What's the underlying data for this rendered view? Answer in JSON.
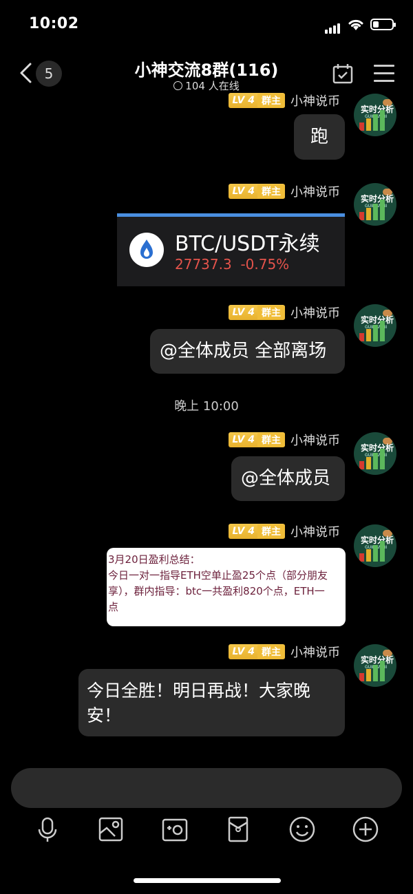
{
  "status_bar": {
    "time": "10:02"
  },
  "header": {
    "back_count": "5",
    "title": "小神交流8群(116)",
    "online": "104 人在线"
  },
  "messages": [
    {
      "sender": "小神说币",
      "level": "LV 4",
      "role": "群主",
      "text": "跑"
    },
    {
      "sender": "小神说币",
      "level": "LV 4",
      "role": "群主",
      "card": {
        "title": "BTC/USDT永续",
        "price": "27737.3",
        "change": "-0.75%"
      }
    },
    {
      "sender": "小神说币",
      "level": "LV 4",
      "role": "群主",
      "text": "@全体成员 全部离场"
    },
    {
      "timestamp": "晚上 10:00"
    },
    {
      "sender": "小神说币",
      "level": "LV 4",
      "role": "群主",
      "text": "@全体成员"
    },
    {
      "sender": "小神说币",
      "level": "LV 4",
      "role": "群主",
      "image_text": [
        "3月20日盈利总结：",
        "今日一对一指导ETH空单止盈25个点（部分朋友",
        "享），群内指导：btc一共盈利820个点，ETH一",
        "点"
      ]
    },
    {
      "sender": "小神说币",
      "level": "LV 4",
      "role": "群主",
      "text_lines": [
        "今日全胜！明日再战！大家晚",
        "安！"
      ]
    }
  ],
  "avatar": {
    "line1": "实时分析",
    "line2": "GUILIAN BI"
  },
  "toolbar": [
    "microphone-icon",
    "image-icon",
    "camera-icon",
    "red-packet-icon",
    "emoji-icon",
    "plus-icon"
  ],
  "colors": {
    "badge": "#f0bd38",
    "card_accent": "#4a8fe0",
    "price_down": "#e5534b"
  }
}
